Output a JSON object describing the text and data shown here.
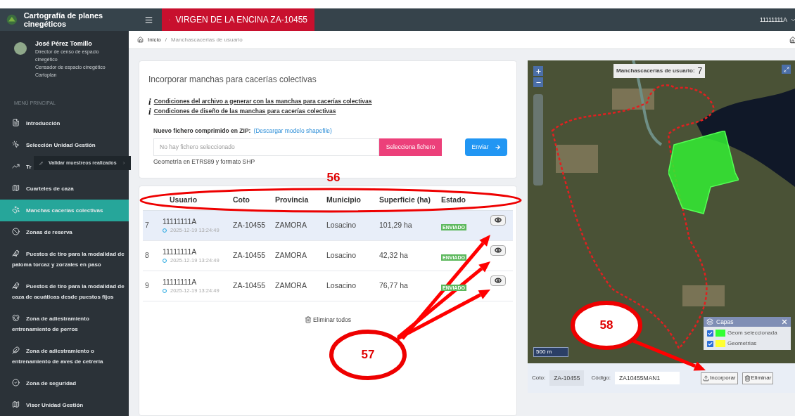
{
  "app": {
    "title": "Cartografía de planes cinegéticos"
  },
  "user": {
    "name": "José Pérez Tomillo",
    "roles": [
      "Director de censo de espacio cinegético",
      "Censador de espacio cinegético",
      "Cartoplan"
    ]
  },
  "sidebar": {
    "heading": "MENÚ PRINCIPAL",
    "items": [
      {
        "label": "Introducción",
        "selected": false
      },
      {
        "label": "Selección Unidad Gestión",
        "selected": false
      },
      {
        "label": "Tr",
        "selected": false
      },
      {
        "label": "Cuarteles de caza",
        "selected": false
      },
      {
        "label": "Manchas cacerías colectivas",
        "selected": true
      },
      {
        "label": "Zonas de reserva",
        "selected": false
      },
      {
        "label": "Puestos de tiro para la modalidad de paloma torcaz y zorzales en paso",
        "selected": false
      },
      {
        "label": "Puestos de tiro para la modalidad de caza de acuáticas desde puestos fijos",
        "selected": false
      },
      {
        "label": "Zona de adiestramiento entrenamiento de perros",
        "selected": false
      },
      {
        "label": "Zona de adiestramiento o entrenamiento de aves de cetrería",
        "selected": false
      },
      {
        "label": "Zona de seguridad",
        "selected": false
      },
      {
        "label": "Visor Unidad Gestión",
        "selected": false
      }
    ],
    "tooltip": "Validar muestreos realizados"
  },
  "header": {
    "title": "VIRGEN DE LA ENCINA ZA-10455",
    "user": "11111111A"
  },
  "breadcrumb": [
    "Inicio",
    "/",
    "Manchascacerias de usuario"
  ],
  "upload_card": {
    "title": "Incorporar manchas para cacerías colectivas",
    "links": [
      {
        "mark": "i",
        "text": "Condiciones del archivo a generar con las manchas para cacerías colectivas"
      },
      {
        "mark": "i",
        "text": "Condiciones de diseño de las manchas para cacerías colectivas"
      }
    ],
    "file_label": "Nuevo fichero comprimido en ZIP:",
    "download_link": "(Descargar modelo shapefile)",
    "file_placeholder": "No hay fichero seleccionado",
    "select_button": "Selecciona fichero",
    "send_button": "Enviar",
    "hint": "Geometría en ETRS89 y formato SHP"
  },
  "table": {
    "columns": [
      "Usuario",
      "Coto",
      "Provincia",
      "Municipio",
      "Superficie (ha)",
      "Estado"
    ],
    "rows": [
      {
        "index": "7",
        "user": "11111111A",
        "timestamp": "2025-12-19 13:24:49",
        "coto": "ZA-10455",
        "provincia": "ZAMORA",
        "municipio": "Losacino",
        "superficie": "101,29 ha",
        "estado": "ENVIADO",
        "selected": true
      },
      {
        "index": "8",
        "user": "11111111A",
        "timestamp": "2025-12-19 13:24:49",
        "coto": "ZA-10455",
        "provincia": "ZAMORA",
        "municipio": "Losacino",
        "superficie": "42,32 ha",
        "estado": "ENVIADO",
        "selected": false
      },
      {
        "index": "9",
        "user": "11111111A",
        "timestamp": "2025-12-19 13:24:49",
        "coto": "ZA-10455",
        "provincia": "ZAMORA",
        "municipio": "Losacino",
        "superficie": "76,77 ha",
        "estado": "ENVIADO",
        "selected": false
      }
    ],
    "delete_all": "Eliminar todos"
  },
  "map": {
    "counter_label": "Manchascacerias de usuario:",
    "counter_value": "7",
    "scale": "500 m",
    "layers": {
      "title": "Capas",
      "items": [
        {
          "label": "Geom seleccionada",
          "checked": true,
          "color": "#33ff33"
        },
        {
          "label": "Geometrias",
          "checked": true,
          "color": "#ffff33"
        }
      ]
    }
  },
  "map_form": {
    "coto_label": "Coto:",
    "coto_value": "ZA-10455",
    "codigo_label": "Código:",
    "codigo_value": "ZA10455MAN1",
    "buttons": [
      "Incorporar",
      "Eliminar"
    ]
  },
  "annotations": [
    {
      "label": "56"
    },
    {
      "label": "57"
    },
    {
      "label": "58"
    }
  ]
}
